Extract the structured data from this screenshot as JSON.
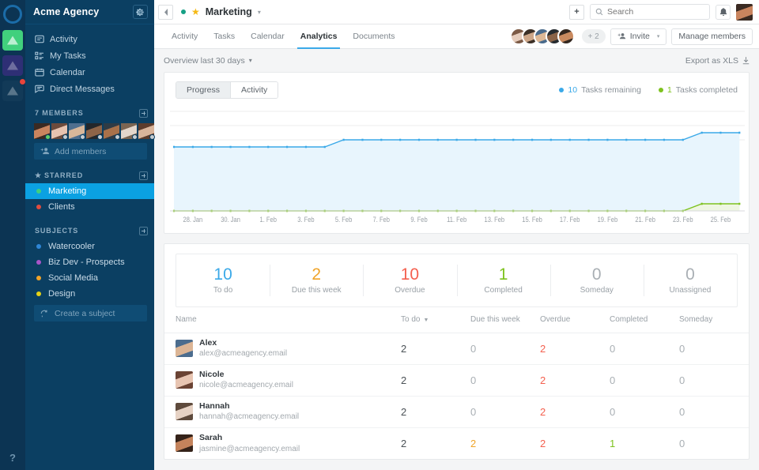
{
  "colors": {
    "rail_bg": "#0c3453",
    "sidebar_bg": "#0b3f62",
    "active_item": "#0ba1e2",
    "accent_blue": "#3ba9e8",
    "green": "#7ec21f",
    "red": "#f4604f",
    "orange": "#f0a429",
    "star_yellow": "#f5b915"
  },
  "rail": {
    "logo_name": "app-logo",
    "tiles": [
      {
        "name": "workspace-acme",
        "bg": "#41d07d",
        "active": true,
        "badge": false
      },
      {
        "name": "workspace-second",
        "bg": "#2e2f75",
        "active": false,
        "badge": false
      },
      {
        "name": "workspace-third",
        "bg": "#123a58",
        "active": false,
        "badge": true
      }
    ],
    "help_label": "?"
  },
  "sidebar": {
    "workspace_title": "Acme Agency",
    "gear_icon": "gear-icon",
    "nav": [
      {
        "label": "Activity",
        "icon": "activity-icon"
      },
      {
        "label": "My Tasks",
        "icon": "tasks-icon"
      },
      {
        "label": "Calendar",
        "icon": "calendar-icon"
      },
      {
        "label": "Direct Messages",
        "icon": "messages-icon"
      }
    ],
    "members": {
      "heading": "7 MEMBERS",
      "count": 7,
      "add_label": "Add members",
      "avatars": [
        {
          "name": "member-avatar-1",
          "c1": "#c9845e",
          "c2": "#3a2a22",
          "status": "#5fd068"
        },
        {
          "name": "member-avatar-2",
          "c1": "#e7c3b0",
          "c2": "#6d4b3c",
          "status": "#c6ccd1"
        },
        {
          "name": "member-avatar-3",
          "c1": "#d8b79a",
          "c2": "#4f6f8f",
          "status": "#c6ccd1"
        },
        {
          "name": "member-avatar-4",
          "c1": "#8d6448",
          "c2": "#23272b",
          "status": "#c6ccd1"
        },
        {
          "name": "member-avatar-5",
          "c1": "#a8714a",
          "c2": "#2f3b45",
          "status": "#c6ccd1"
        },
        {
          "name": "member-avatar-6",
          "c1": "#e3d6cb",
          "c2": "#7b6552",
          "status": "#c6ccd1"
        },
        {
          "name": "member-avatar-7",
          "c1": "#d9b49a",
          "c2": "#5d3c2c",
          "status": "#c6ccd1"
        }
      ]
    },
    "starred": {
      "heading": "STARRED",
      "items": [
        {
          "label": "Marketing",
          "dot": "#16a085",
          "active": true
        },
        {
          "label": "Clients",
          "dot": "#e04c3f",
          "active": false
        }
      ]
    },
    "subjects": {
      "heading": "SUBJECTS",
      "items": [
        {
          "label": "Watercooler",
          "dot": "#2f86d6"
        },
        {
          "label": "Biz Dev - Prospects",
          "dot": "#a855c9"
        },
        {
          "label": "Social Media",
          "dot": "#f0a429"
        },
        {
          "label": "Design",
          "dot": "#e6d216"
        }
      ],
      "create_label": "Create a subject",
      "create_icon": "refresh-icon"
    }
  },
  "topbar": {
    "back_icon": "chevron-left-icon",
    "project_dot": "#16a085",
    "star_icon": "star-icon",
    "project_name": "Marketing",
    "project_caret": "chevron-down-icon",
    "add_icon": "plus-icon",
    "search_placeholder": "Search",
    "search_value": "",
    "search_icon": "search-icon",
    "bell_icon": "bell-icon",
    "avatar_name": "user-avatar"
  },
  "tabs": [
    {
      "label": "Activity",
      "active": false
    },
    {
      "label": "Tasks",
      "active": false
    },
    {
      "label": "Calendar",
      "active": false
    },
    {
      "label": "Analytics",
      "active": true
    },
    {
      "label": "Documents",
      "active": false
    }
  ],
  "tab_right": {
    "facepile": [
      {
        "name": "facepile-avatar-1",
        "c1": "#e6cdbd",
        "c2": "#7c5a46"
      },
      {
        "name": "facepile-avatar-2",
        "c1": "#cda688",
        "c2": "#3c3027"
      },
      {
        "name": "facepile-avatar-3",
        "c1": "#ddb896",
        "c2": "#4a6b8c"
      },
      {
        "name": "facepile-avatar-4",
        "c1": "#8a6348",
        "c2": "#262b30"
      },
      {
        "name": "facepile-avatar-5",
        "c1": "#c98a5f",
        "c2": "#33271f"
      }
    ],
    "overflow_label": "+ 2",
    "invite_label": "Invite",
    "invite_icon": "add-person-icon",
    "invite_caret": "chevron-down-icon",
    "manage_label": "Manage members"
  },
  "overview": {
    "label": "Overview last 30 days",
    "caret": "chevron-down-icon",
    "export_label": "Export as XLS",
    "export_icon": "download-icon"
  },
  "chart_card": {
    "segments": [
      {
        "label": "Progress",
        "active": true
      },
      {
        "label": "Activity",
        "active": false
      }
    ],
    "legend": [
      {
        "value": "10",
        "label": "Tasks remaining",
        "color": "#3ba9e8"
      },
      {
        "value": "1",
        "label": "Tasks completed",
        "color": "#7ec21f"
      }
    ]
  },
  "chart_data": {
    "type": "line",
    "title": "",
    "xlabel": "",
    "ylabel": "",
    "grid": true,
    "legend_position": "top-right",
    "ylim": [
      0,
      14
    ],
    "x": [
      "27. Jan",
      "28. Jan",
      "29. Jan",
      "30. Jan",
      "31. Jan",
      "1. Feb",
      "2. Feb",
      "3. Feb",
      "4. Feb",
      "5. Feb",
      "6. Feb",
      "7. Feb",
      "8. Feb",
      "9. Feb",
      "10. Feb",
      "11. Feb",
      "12. Feb",
      "13. Feb",
      "14. Feb",
      "15. Feb",
      "16. Feb",
      "17. Feb",
      "18. Feb",
      "19. Feb",
      "20. Feb",
      "21. Feb",
      "22. Feb",
      "23. Feb",
      "24. Feb",
      "25. Feb",
      "26. Feb"
    ],
    "tick_labels": [
      "28. Jan",
      "30. Jan",
      "1. Feb",
      "3. Feb",
      "5. Feb",
      "7. Feb",
      "9. Feb",
      "11. Feb",
      "13. Feb",
      "15. Feb",
      "17. Feb",
      "19. Feb",
      "21. Feb",
      "23. Feb",
      "25. Feb"
    ],
    "series": [
      {
        "name": "Tasks remaining",
        "color": "#3ba9e8",
        "fill": "#e8f5fd",
        "values": [
          9,
          9,
          9,
          9,
          9,
          9,
          9,
          9,
          9,
          10,
          10,
          10,
          10,
          10,
          10,
          10,
          10,
          10,
          10,
          10,
          10,
          10,
          10,
          10,
          10,
          10,
          10,
          10,
          11,
          11,
          11
        ]
      },
      {
        "name": "Tasks completed",
        "color": "#7ec21f",
        "fill": "#eef6e2",
        "values": [
          0,
          0,
          0,
          0,
          0,
          0,
          0,
          0,
          0,
          0,
          0,
          0,
          0,
          0,
          0,
          0,
          0,
          0,
          0,
          0,
          0,
          0,
          0,
          0,
          0,
          0,
          0,
          0,
          1,
          1,
          1
        ]
      }
    ]
  },
  "stats": [
    {
      "num": "10",
      "label": "To do",
      "color": "#3ba9e8"
    },
    {
      "num": "2",
      "label": "Due this week",
      "color": "#f0a429"
    },
    {
      "num": "10",
      "label": "Overdue",
      "color": "#f4604f"
    },
    {
      "num": "1",
      "label": "Completed",
      "color": "#7ec21f"
    },
    {
      "num": "0",
      "label": "Someday",
      "color": "#a9afb4"
    },
    {
      "num": "0",
      "label": "Unassigned",
      "color": "#a9afb4"
    }
  ],
  "table": {
    "columns": [
      {
        "label": "Name",
        "sorted": false
      },
      {
        "label": "To do",
        "sorted": true
      },
      {
        "label": "Due this week",
        "sorted": false
      },
      {
        "label": "Overdue",
        "sorted": false
      },
      {
        "label": "Completed",
        "sorted": false
      },
      {
        "label": "Someday",
        "sorted": false
      }
    ],
    "rows": [
      {
        "name": "Alex",
        "email": "alex@acmeagency.email",
        "avatar": {
          "name": "row-avatar-alex",
          "c1": "#dcb595",
          "c2": "#4c6d8e"
        },
        "todo": "2",
        "due": "0",
        "overdue": "2",
        "completed": "0",
        "someday": "0",
        "due_color": "zero",
        "overdue_color": "red",
        "completed_color": "zero"
      },
      {
        "name": "Nicole",
        "email": "nicole@acmeagency.email",
        "avatar": {
          "name": "row-avatar-nicole",
          "c1": "#e8c5b2",
          "c2": "#6b4334"
        },
        "todo": "2",
        "due": "0",
        "overdue": "2",
        "completed": "0",
        "someday": "0",
        "due_color": "zero",
        "overdue_color": "red",
        "completed_color": "zero"
      },
      {
        "name": "Hannah",
        "email": "hannah@acmeagency.email",
        "avatar": {
          "name": "row-avatar-hannah",
          "c1": "#e6d2c4",
          "c2": "#5e4a3c"
        },
        "todo": "2",
        "due": "0",
        "overdue": "2",
        "completed": "0",
        "someday": "0",
        "due_color": "zero",
        "overdue_color": "red",
        "completed_color": "zero"
      },
      {
        "name": "Sarah",
        "email": "jasmine@acmeagency.email",
        "avatar": {
          "name": "row-avatar-sarah",
          "c1": "#c4835c",
          "c2": "#342219"
        },
        "todo": "2",
        "due": "2",
        "overdue": "2",
        "completed": "1",
        "someday": "0",
        "due_color": "orange",
        "overdue_color": "red",
        "completed_color": "green"
      }
    ]
  }
}
